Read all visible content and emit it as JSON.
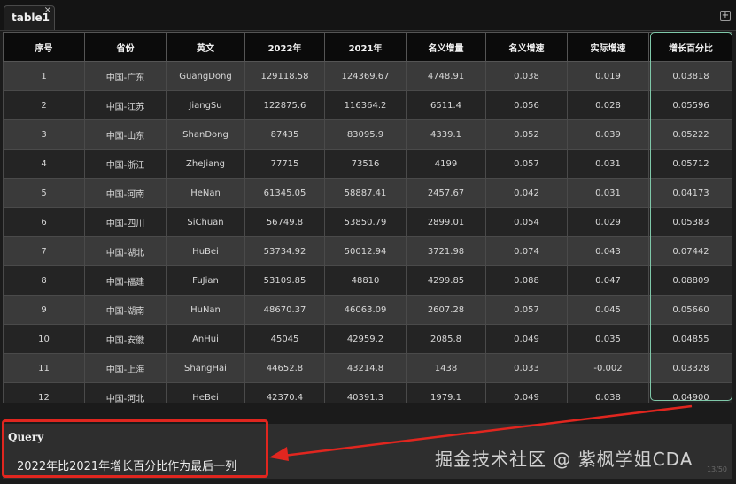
{
  "tab": {
    "label": "table1",
    "close": "×",
    "add": "+"
  },
  "table": {
    "columns": [
      "序号",
      "省份",
      "英文",
      "2022年",
      "2021年",
      "名义增量",
      "名义增速",
      "实际增速",
      "增长百分比"
    ],
    "rows": [
      [
        "1",
        "中国-广东",
        "GuangDong",
        "129118.58",
        "124369.67",
        "4748.91",
        "0.038",
        "0.019",
        "0.03818"
      ],
      [
        "2",
        "中国-江苏",
        "JiangSu",
        "122875.6",
        "116364.2",
        "6511.4",
        "0.056",
        "0.028",
        "0.05596"
      ],
      [
        "3",
        "中国-山东",
        "ShanDong",
        "87435",
        "83095.9",
        "4339.1",
        "0.052",
        "0.039",
        "0.05222"
      ],
      [
        "4",
        "中国-浙江",
        "ZheJiang",
        "77715",
        "73516",
        "4199",
        "0.057",
        "0.031",
        "0.05712"
      ],
      [
        "5",
        "中国-河南",
        "HeNan",
        "61345.05",
        "58887.41",
        "2457.67",
        "0.042",
        "0.031",
        "0.04173"
      ],
      [
        "6",
        "中国-四川",
        "SiChuan",
        "56749.8",
        "53850.79",
        "2899.01",
        "0.054",
        "0.029",
        "0.05383"
      ],
      [
        "7",
        "中国-湖北",
        "HuBei",
        "53734.92",
        "50012.94",
        "3721.98",
        "0.074",
        "0.043",
        "0.07442"
      ],
      [
        "8",
        "中国-福建",
        "FuJian",
        "53109.85",
        "48810",
        "4299.85",
        "0.088",
        "0.047",
        "0.08809"
      ],
      [
        "9",
        "中国-湖南",
        "HuNan",
        "48670.37",
        "46063.09",
        "2607.28",
        "0.057",
        "0.045",
        "0.05660"
      ],
      [
        "10",
        "中国-安徽",
        "AnHui",
        "45045",
        "42959.2",
        "2085.8",
        "0.049",
        "0.035",
        "0.04855"
      ],
      [
        "11",
        "中国-上海",
        "ShangHai",
        "44652.8",
        "43214.8",
        "1438",
        "0.033",
        "-0.002",
        "0.03328"
      ],
      [
        "12",
        "中国-河北",
        "HeBei",
        "42370.4",
        "40391.3",
        "1979.1",
        "0.049",
        "0.038",
        "0.04900"
      ]
    ]
  },
  "query": {
    "title": "Query",
    "text": "2022年比2021年增长百分比作为最后一列"
  },
  "watermark": "掘金技术社区 @ 紫枫学姐CDA",
  "pager": "13/50",
  "colors": {
    "annotation": "#e0261f",
    "highlight_column": "#7fc8a9",
    "header_bg": "#0b0b0b"
  }
}
